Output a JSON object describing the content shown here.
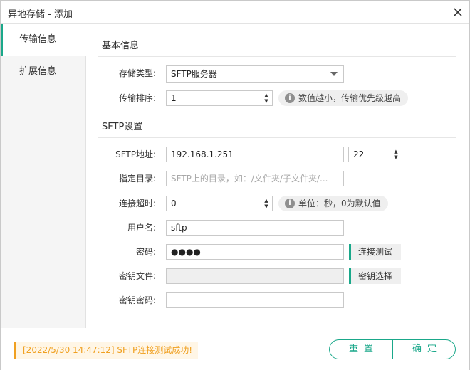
{
  "window": {
    "title": "异地存储 - 添加"
  },
  "sidebar": {
    "tabs": [
      {
        "label": "传输信息"
      },
      {
        "label": "扩展信息"
      }
    ]
  },
  "basic": {
    "section_title": "基本信息",
    "storage_type": {
      "label": "存储类型:",
      "value": "SFTP服务器"
    },
    "priority": {
      "label": "传输排序:",
      "value": "1",
      "hint": "数值越小，传输优先级越高"
    }
  },
  "sftp": {
    "section_title": "SFTP设置",
    "address": {
      "label": "SFTP地址:",
      "value": "192.168.1.251",
      "port": "22"
    },
    "directory": {
      "label": "指定目录:",
      "placeholder": "SFTP上的目录，如：/文件夹/子文件夹/..."
    },
    "timeout": {
      "label": "连接超时:",
      "value": "0",
      "hint": "单位：秒，0为默认值"
    },
    "username": {
      "label": "用户名:",
      "value": "sftp"
    },
    "password": {
      "label": "密码:",
      "value": "●●●●",
      "test_button": "连接测试"
    },
    "keyfile": {
      "label": "密钥文件:",
      "value": "",
      "select_button": "密钥选择"
    },
    "keypass": {
      "label": "密钥密码:",
      "value": ""
    }
  },
  "footer": {
    "status": "[2022/5/30  14:47:12]  SFTP连接测试成功!",
    "reset_label": "重置",
    "confirm_label": "确定"
  },
  "colors": {
    "accent": "#1aa88a",
    "warning": "#f0a020"
  }
}
